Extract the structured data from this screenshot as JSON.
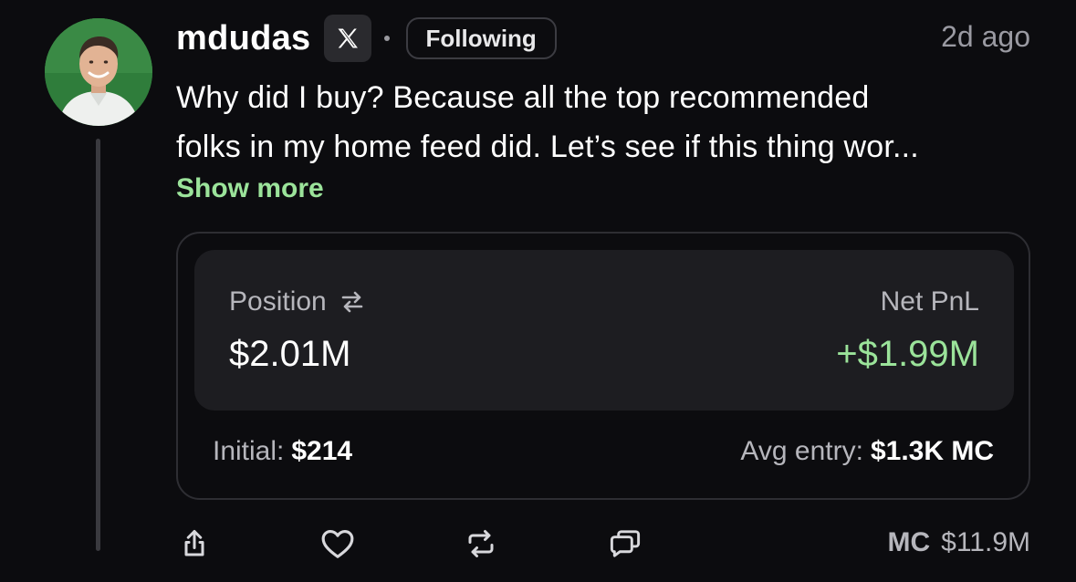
{
  "post": {
    "username": "mdudas",
    "platform_icon": "x-logo-icon",
    "follow_label": "Following",
    "timestamp": "2d ago",
    "text_line1": "Why did I buy? Because all the top recommended",
    "text_line2": "folks in my home feed did. Let’s see if this thing wor...",
    "show_more": "Show more"
  },
  "position_card": {
    "position_label": "Position",
    "position_value": "$2.01M",
    "pnl_label": "Net PnL",
    "pnl_value": "+$1.99M",
    "initial_label": "Initial:",
    "initial_value": "$214",
    "avg_entry_label": "Avg entry:",
    "avg_entry_value": "$1.3K MC"
  },
  "actions": {
    "icons": [
      "share-icon",
      "heart-icon",
      "repost-icon",
      "comment-icon"
    ],
    "mc_label": "MC",
    "mc_value": "$11.9M"
  },
  "colors": {
    "background": "#0c0c0f",
    "accent_green": "#9be39a",
    "muted_text": "#b6b6bc",
    "card_inner": "#1d1d21"
  }
}
